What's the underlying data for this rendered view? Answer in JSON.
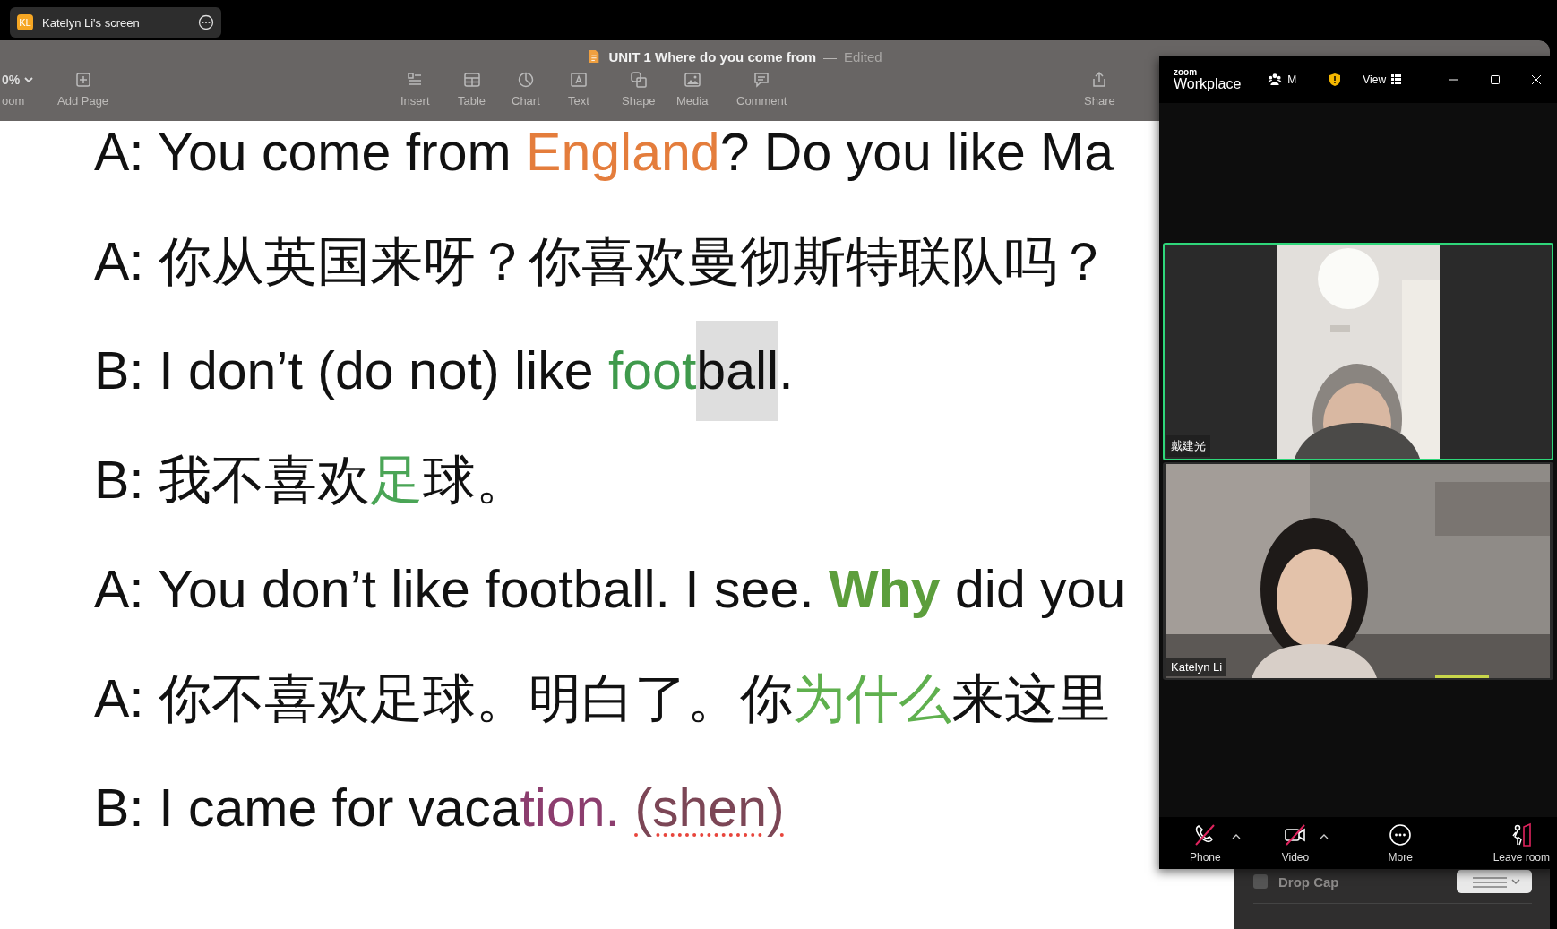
{
  "share_tab": {
    "avatar": "KL",
    "label": "Katelyn Li's screen"
  },
  "document": {
    "title": "UNIT 1 Where do you come from",
    "separator": "—",
    "status": "Edited"
  },
  "toolbar": {
    "zoom_value": "0%",
    "items": [
      {
        "label": "oom",
        "kind": "zoom"
      },
      {
        "label": "Add Page",
        "kind": "add-page"
      },
      {
        "label": "Insert",
        "kind": "insert"
      },
      {
        "label": "Table",
        "kind": "table"
      },
      {
        "label": "Chart",
        "kind": "chart"
      },
      {
        "label": "Text",
        "kind": "text"
      },
      {
        "label": "Shape",
        "kind": "shape"
      },
      {
        "label": "Media",
        "kind": "media"
      },
      {
        "label": "Comment",
        "kind": "comment"
      },
      {
        "label": "Share",
        "kind": "share"
      }
    ]
  },
  "lines": [
    {
      "segments": [
        {
          "text": "A: You come from "
        },
        {
          "text": "England",
          "color": "#e47d3c"
        },
        {
          "text": "? Do you like Ma"
        }
      ]
    },
    {
      "segments": [
        {
          "text": "A: 你从英国来呀？你喜欢曼彻斯特联队吗？"
        }
      ]
    },
    {
      "segments": [
        {
          "text": "B: I don’t (do not) like "
        },
        {
          "text": "foot",
          "color": "#3f9a4c"
        },
        {
          "text": "ball",
          "highlighted": true
        },
        {
          "text": "."
        }
      ]
    },
    {
      "segments": [
        {
          "text": "B: 我不喜欢"
        },
        {
          "text": "足",
          "color": "#4aa556"
        },
        {
          "text": "球。"
        }
      ]
    },
    {
      "segments": [
        {
          "text": "A: You don’t like football. I see. "
        },
        {
          "text": "Why",
          "color": "#5c9e3c",
          "bold": true
        },
        {
          "text": " did you"
        }
      ]
    },
    {
      "segments": [
        {
          "text": "A: 你不喜欢足球。明白了。你"
        },
        {
          "text": "为什么",
          "color": "#5fb04e"
        },
        {
          "text": "来这里"
        }
      ]
    },
    {
      "segments": [
        {
          "text": "B: I came for vaca"
        },
        {
          "text": "tion. ",
          "color": "#8c3d6e"
        },
        {
          "text": "(shen)",
          "color": "#7c4656",
          "misspelled": true
        }
      ]
    }
  ],
  "inspector": {
    "drop_cap": {
      "label": "Drop Cap",
      "checked": false
    }
  },
  "zoom": {
    "brand": "zoom",
    "product": "Workplace",
    "participants_label": "M",
    "view_label": "View",
    "tiles": [
      {
        "name": "戴建光",
        "speaking": true
      },
      {
        "name": "Katelyn Li",
        "speaking": false
      }
    ],
    "controls": [
      {
        "label": "Phone",
        "kind": "phone",
        "off": true,
        "has_menu": true
      },
      {
        "label": "Video",
        "kind": "video",
        "off": true,
        "has_menu": true
      },
      {
        "label": "More",
        "kind": "more",
        "off": false,
        "has_menu": false
      },
      {
        "label": "Leave room",
        "kind": "leave",
        "off": false,
        "has_menu": false
      }
    ]
  }
}
